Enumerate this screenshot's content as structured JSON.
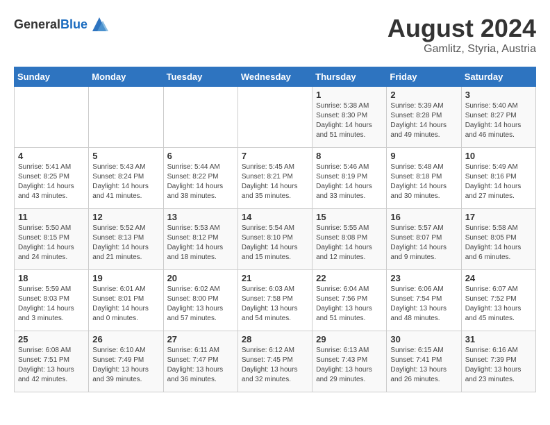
{
  "header": {
    "logo_general": "General",
    "logo_blue": "Blue",
    "month_year": "August 2024",
    "location": "Gamlitz, Styria, Austria"
  },
  "weekdays": [
    "Sunday",
    "Monday",
    "Tuesday",
    "Wednesday",
    "Thursday",
    "Friday",
    "Saturday"
  ],
  "weeks": [
    [
      {
        "day": "",
        "info": ""
      },
      {
        "day": "",
        "info": ""
      },
      {
        "day": "",
        "info": ""
      },
      {
        "day": "",
        "info": ""
      },
      {
        "day": "1",
        "info": "Sunrise: 5:38 AM\nSunset: 8:30 PM\nDaylight: 14 hours\nand 51 minutes."
      },
      {
        "day": "2",
        "info": "Sunrise: 5:39 AM\nSunset: 8:28 PM\nDaylight: 14 hours\nand 49 minutes."
      },
      {
        "day": "3",
        "info": "Sunrise: 5:40 AM\nSunset: 8:27 PM\nDaylight: 14 hours\nand 46 minutes."
      }
    ],
    [
      {
        "day": "4",
        "info": "Sunrise: 5:41 AM\nSunset: 8:25 PM\nDaylight: 14 hours\nand 43 minutes."
      },
      {
        "day": "5",
        "info": "Sunrise: 5:43 AM\nSunset: 8:24 PM\nDaylight: 14 hours\nand 41 minutes."
      },
      {
        "day": "6",
        "info": "Sunrise: 5:44 AM\nSunset: 8:22 PM\nDaylight: 14 hours\nand 38 minutes."
      },
      {
        "day": "7",
        "info": "Sunrise: 5:45 AM\nSunset: 8:21 PM\nDaylight: 14 hours\nand 35 minutes."
      },
      {
        "day": "8",
        "info": "Sunrise: 5:46 AM\nSunset: 8:19 PM\nDaylight: 14 hours\nand 33 minutes."
      },
      {
        "day": "9",
        "info": "Sunrise: 5:48 AM\nSunset: 8:18 PM\nDaylight: 14 hours\nand 30 minutes."
      },
      {
        "day": "10",
        "info": "Sunrise: 5:49 AM\nSunset: 8:16 PM\nDaylight: 14 hours\nand 27 minutes."
      }
    ],
    [
      {
        "day": "11",
        "info": "Sunrise: 5:50 AM\nSunset: 8:15 PM\nDaylight: 14 hours\nand 24 minutes."
      },
      {
        "day": "12",
        "info": "Sunrise: 5:52 AM\nSunset: 8:13 PM\nDaylight: 14 hours\nand 21 minutes."
      },
      {
        "day": "13",
        "info": "Sunrise: 5:53 AM\nSunset: 8:12 PM\nDaylight: 14 hours\nand 18 minutes."
      },
      {
        "day": "14",
        "info": "Sunrise: 5:54 AM\nSunset: 8:10 PM\nDaylight: 14 hours\nand 15 minutes."
      },
      {
        "day": "15",
        "info": "Sunrise: 5:55 AM\nSunset: 8:08 PM\nDaylight: 14 hours\nand 12 minutes."
      },
      {
        "day": "16",
        "info": "Sunrise: 5:57 AM\nSunset: 8:07 PM\nDaylight: 14 hours\nand 9 minutes."
      },
      {
        "day": "17",
        "info": "Sunrise: 5:58 AM\nSunset: 8:05 PM\nDaylight: 14 hours\nand 6 minutes."
      }
    ],
    [
      {
        "day": "18",
        "info": "Sunrise: 5:59 AM\nSunset: 8:03 PM\nDaylight: 14 hours\nand 3 minutes."
      },
      {
        "day": "19",
        "info": "Sunrise: 6:01 AM\nSunset: 8:01 PM\nDaylight: 14 hours\nand 0 minutes."
      },
      {
        "day": "20",
        "info": "Sunrise: 6:02 AM\nSunset: 8:00 PM\nDaylight: 13 hours\nand 57 minutes."
      },
      {
        "day": "21",
        "info": "Sunrise: 6:03 AM\nSunset: 7:58 PM\nDaylight: 13 hours\nand 54 minutes."
      },
      {
        "day": "22",
        "info": "Sunrise: 6:04 AM\nSunset: 7:56 PM\nDaylight: 13 hours\nand 51 minutes."
      },
      {
        "day": "23",
        "info": "Sunrise: 6:06 AM\nSunset: 7:54 PM\nDaylight: 13 hours\nand 48 minutes."
      },
      {
        "day": "24",
        "info": "Sunrise: 6:07 AM\nSunset: 7:52 PM\nDaylight: 13 hours\nand 45 minutes."
      }
    ],
    [
      {
        "day": "25",
        "info": "Sunrise: 6:08 AM\nSunset: 7:51 PM\nDaylight: 13 hours\nand 42 minutes."
      },
      {
        "day": "26",
        "info": "Sunrise: 6:10 AM\nSunset: 7:49 PM\nDaylight: 13 hours\nand 39 minutes."
      },
      {
        "day": "27",
        "info": "Sunrise: 6:11 AM\nSunset: 7:47 PM\nDaylight: 13 hours\nand 36 minutes."
      },
      {
        "day": "28",
        "info": "Sunrise: 6:12 AM\nSunset: 7:45 PM\nDaylight: 13 hours\nand 32 minutes."
      },
      {
        "day": "29",
        "info": "Sunrise: 6:13 AM\nSunset: 7:43 PM\nDaylight: 13 hours\nand 29 minutes."
      },
      {
        "day": "30",
        "info": "Sunrise: 6:15 AM\nSunset: 7:41 PM\nDaylight: 13 hours\nand 26 minutes."
      },
      {
        "day": "31",
        "info": "Sunrise: 6:16 AM\nSunset: 7:39 PM\nDaylight: 13 hours\nand 23 minutes."
      }
    ]
  ]
}
